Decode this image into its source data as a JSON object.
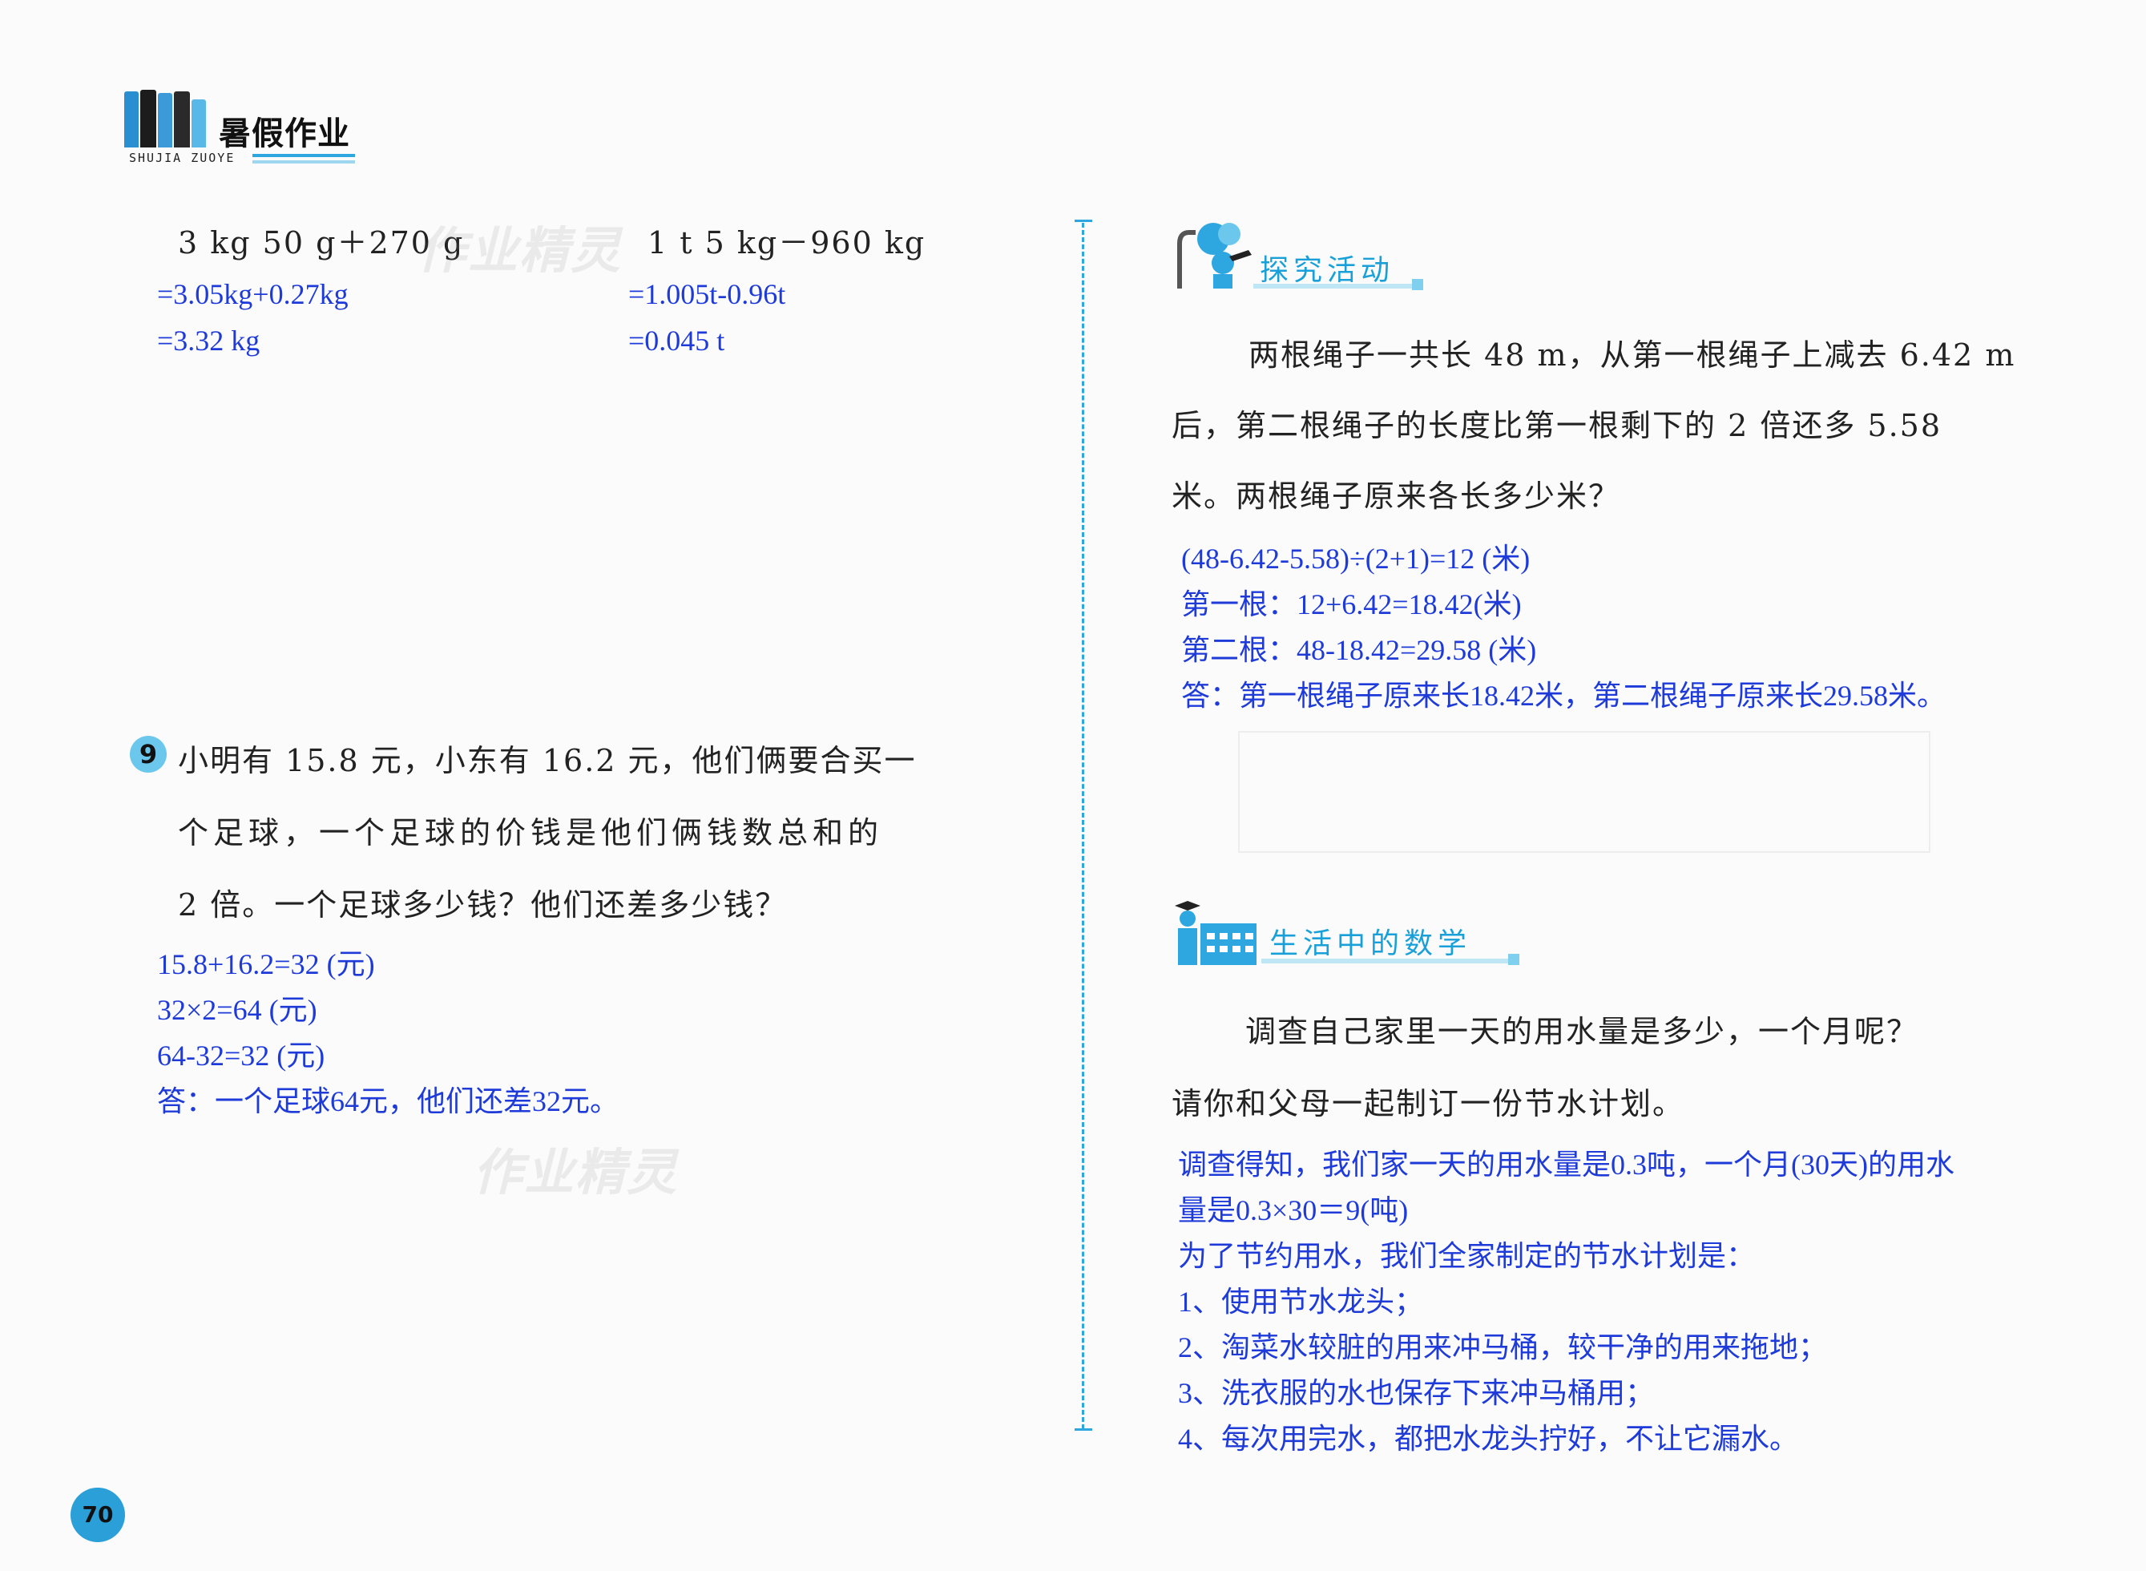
{
  "header": {
    "title": "暑假作业",
    "subtitle": "SHUJIA ZUOYE"
  },
  "left": {
    "expr1": "3 kg 50 g＋270 g",
    "expr1_ans": [
      "=3.05kg+0.27kg",
      "=3.32 kg"
    ],
    "expr2": "1 t 5 kg－960 kg",
    "expr2_ans": [
      "=1.005t-0.96t",
      "=0.045 t"
    ],
    "q9": {
      "number": "9",
      "lines": [
        "小明有 15.8 元，小东有 16.2 元，他们俩要合买一",
        "个足球，一个足球的价钱是他们俩钱数总和的",
        "2 倍。一个足球多少钱？他们还差多少钱？"
      ],
      "answers": [
        "15.8+16.2=32 (元)",
        "32×2=64 (元)",
        "64-32=32 (元)",
        "答：一个足球64元，他们还差32元。"
      ]
    }
  },
  "right": {
    "section1": {
      "title": "探究活动",
      "lines": [
        "两根绳子一共长 48 m，从第一根绳子上减去 6.42 m",
        "后，第二根绳子的长度比第一根剩下的 2 倍还多 5.58",
        "米。两根绳子原来各长多少米？"
      ],
      "answers": [
        "(48-6.42-5.58)÷(2+1)=12 (米)",
        "第一根：12+6.42=18.42(米)",
        "第二根：48-18.42=29.58 (米)",
        "答：第一根绳子原来长18.42米，第二根绳子原来长29.58米。"
      ]
    },
    "section2": {
      "title": "生活中的数学",
      "lines": [
        "调查自己家里一天的用水量是多少，一个月呢？",
        "请你和父母一起制订一份节水计划。"
      ],
      "answers": [
        "调查得知，我们家一天的用水量是0.3吨，一个月(30天)的用水",
        "量是0.3×30＝9(吨)",
        "为了节约用水，我们全家制定的节水计划是：",
        "1、使用节水龙头；",
        "2、淘菜水较脏的用来冲马桶，较干净的用来拖地；",
        "3、洗衣服的水也保存下来冲马桶用；",
        "4、每次用完水，都把水龙头拧好，不让它漏水。"
      ]
    }
  },
  "page_number": "70",
  "colors": {
    "answer": "#1e3bd9",
    "accent": "#2ea7e0",
    "banner_text": "#1aa0d8"
  }
}
